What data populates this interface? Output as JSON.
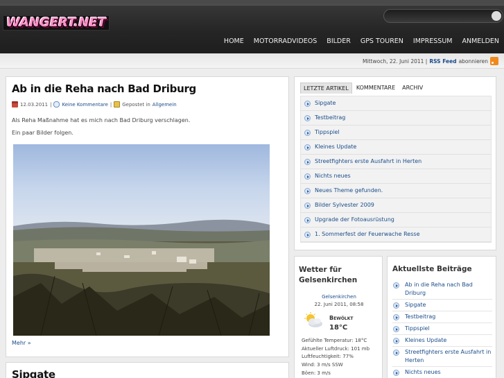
{
  "header": {
    "logo_text": "WANGERT.NET",
    "search_placeholder": "",
    "nav": [
      "HOME",
      "MOTORRADVIDEOS",
      "BILDER",
      "GPS TOUREN",
      "IMPRESSUM",
      "ANMELDEN"
    ]
  },
  "subbar": {
    "date": "Mittwoch, 22. Juni 2011 |",
    "feed_label": "RSS Feed",
    "feed_suffix": "abonnieren"
  },
  "post1": {
    "title": "Ab in die Reha nach Bad Driburg",
    "date": "12.03.2011",
    "comments": "Keine Kommentare",
    "posted_in": "Gepostet in",
    "category": "Allgemein",
    "para1": "Als Reha Maßnahme hat es mich nach Bad Driburg verschlagen.",
    "para2": "Ein paar Bilder folgen.",
    "more": "Mehr »"
  },
  "post2": {
    "title": "Sipgate"
  },
  "tabs_widget": {
    "tabs": [
      "LETZTE ARTIKEL",
      "KOMMENTARE",
      "ARCHIV"
    ],
    "items": [
      "Sipgate",
      "Testbeitrag",
      "Tippspiel",
      "Kleines Update",
      "Streetfighters erste Ausfahrt in Herten",
      "Nichts neues",
      "Neues Theme gefunden.",
      "Bilder Sylvester 2009",
      "Upgrade der Fotoausrüstung",
      "1. Sommerfest der Feuerwache Resse"
    ]
  },
  "weather": {
    "title_line1": "Wetter für",
    "title_line2": "Gelsenkirchen",
    "city": "Gelsenkirchen",
    "date": "22. Juni 2011, 08:58",
    "condition": "Bewölkt",
    "temp": "18°C",
    "icon": "partly-cloudy-icon",
    "details": [
      "Gefühlte Temperatur: 18°C",
      "Aktueller Luftdruck: 101 mb",
      "Luftfeuchtigkeit: 77%",
      "Wind: 3 m/s SSW",
      "Böen: 3 m/s"
    ]
  },
  "recent": {
    "title": "Aktuellste Beiträge",
    "items": [
      "Ab in die Reha nach Bad Driburg",
      "Sipgate",
      "Testbeitrag",
      "Tippspiel",
      "Kleines Update",
      "Streetfighters erste Ausfahrt in Herten",
      "Nichts neues"
    ]
  }
}
